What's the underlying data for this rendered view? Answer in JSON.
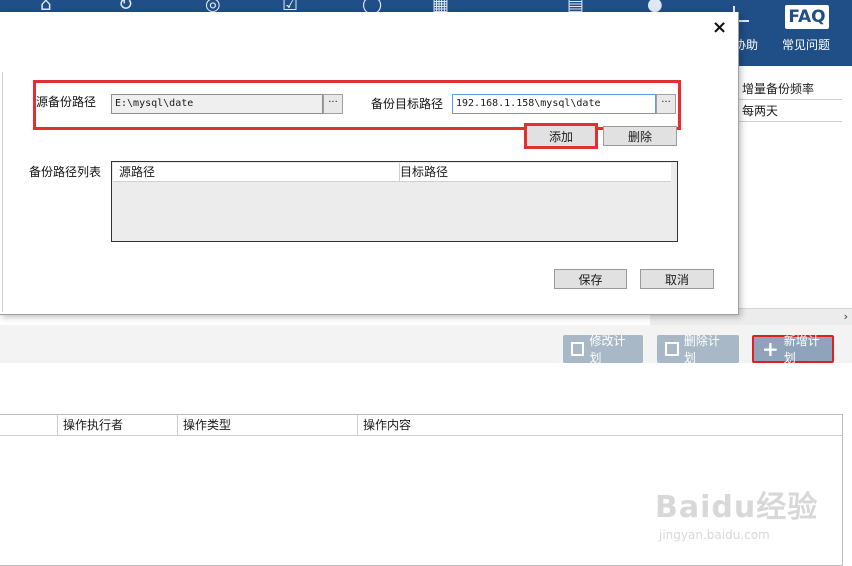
{
  "toolbar": {
    "help_label": "协助",
    "faq_badge": "FAQ",
    "faq_label": "常见问题"
  },
  "right_grid": {
    "header": "增量备份频率",
    "rows": [
      "每两天"
    ]
  },
  "plan_buttons": {
    "edit": "修改计划",
    "delete": "删除计划",
    "add": "新增计划"
  },
  "log_table": {
    "columns": [
      "操作执行者",
      "操作类型",
      "操作内容"
    ]
  },
  "watermark": {
    "logo": "Baidu经验",
    "url": "jingyan.baidu.com"
  },
  "dialog": {
    "close_glyph": "×",
    "source_label": "源备份路径",
    "source_value": "E:\\mysql\\date",
    "target_label": "备份目标路径",
    "target_value": "192.168.1.158\\mysql\\date",
    "browse_glyph": "···",
    "add_label": "添加",
    "delete_label": "删除",
    "list_label": "备份路径列表",
    "list_columns": [
      "源路径",
      "目标路径"
    ],
    "save_label": "保存",
    "cancel_label": "取消"
  },
  "colors": {
    "toolbar_bg": "#1f4f86",
    "highlight_red": "#e03030"
  }
}
